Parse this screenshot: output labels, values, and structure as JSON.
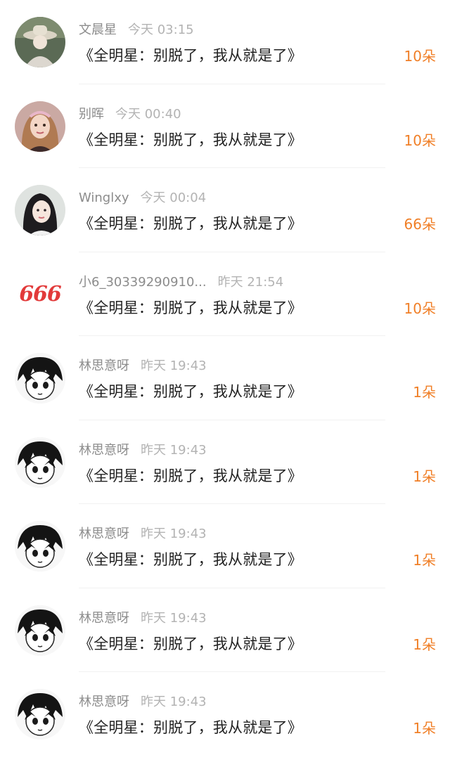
{
  "comments": [
    {
      "username": "文晨星",
      "time": "今天 03:15",
      "message": "《全明星：别脱了，我从就是了》",
      "gift": "10朵",
      "avatar": "photo-hat-icon"
    },
    {
      "username": "别晖",
      "time": "今天 00:40",
      "message": "《全明星：别脱了，我从就是了》",
      "gift": "10朵",
      "avatar": "photo-girl-icon"
    },
    {
      "username": "Winglxy",
      "time": "今天 00:04",
      "message": "《全明星：别脱了，我从就是了》",
      "gift": "66朵",
      "avatar": "photo-woman-icon"
    },
    {
      "username": "小6_30339290910...",
      "time": "昨天 21:54",
      "message": "《全明星：别脱了，我从就是了》",
      "gift": "10朵",
      "avatar": "text-666",
      "avatar_text": "666"
    },
    {
      "username": "林思意呀",
      "time": "昨天 19:43",
      "message": "《全明星：别脱了，我从就是了》",
      "gift": "1朵",
      "avatar": "anime-sketch-icon"
    },
    {
      "username": "林思意呀",
      "time": "昨天 19:43",
      "message": "《全明星：别脱了，我从就是了》",
      "gift": "1朵",
      "avatar": "anime-sketch-icon"
    },
    {
      "username": "林思意呀",
      "time": "昨天 19:43",
      "message": "《全明星：别脱了，我从就是了》",
      "gift": "1朵",
      "avatar": "anime-sketch-icon"
    },
    {
      "username": "林思意呀",
      "time": "昨天 19:43",
      "message": "《全明星：别脱了，我从就是了》",
      "gift": "1朵",
      "avatar": "anime-sketch-icon"
    },
    {
      "username": "林思意呀",
      "time": "昨天 19:43",
      "message": "《全明星：别脱了，我从就是了》",
      "gift": "1朵",
      "avatar": "anime-sketch-icon"
    }
  ],
  "colors": {
    "username": "#8c8c8c",
    "time": "#b3b3b3",
    "message": "#222222",
    "gift": "#f07f27",
    "avatar_text": "#e23a3a"
  }
}
